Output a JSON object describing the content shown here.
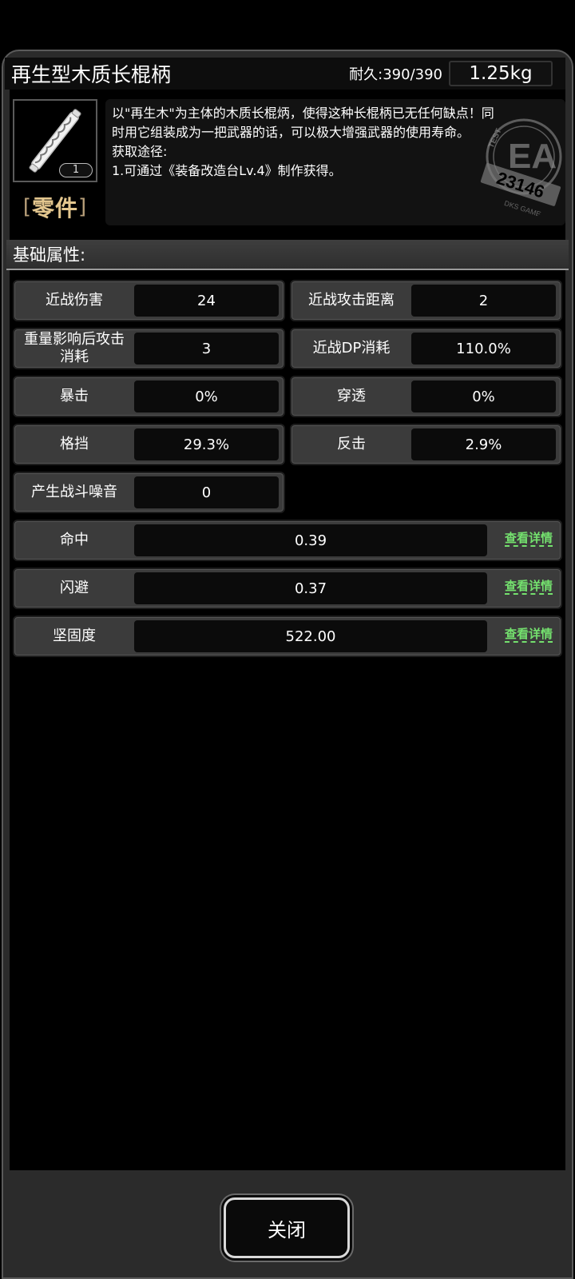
{
  "header": {
    "item_name": "再生型木质长棍柄",
    "durability": "耐久:390/390",
    "weight": "1.25kg"
  },
  "item": {
    "icon": "wooden-staff-handle-icon",
    "count": "1",
    "category": "零件",
    "description_lines": [
      "以\"再生木\"为主体的木质长棍炳，使得这种长棍柄已无任何缺点！同",
      "时用它组装成为一把武器的话，可以极大增强武器的使用寿命。",
      "获取途径:",
      "1.可通过《装备改造台Lv.4》制作获得。"
    ],
    "stamp": {
      "big": "EA",
      "small": "TEST",
      "number": "23146",
      "ring": "DKS GAME"
    }
  },
  "section": {
    "title": "基础属性:"
  },
  "stats_grid": [
    {
      "label": "近战伤害",
      "value": "24"
    },
    {
      "label": "近战攻击距离",
      "value": "2"
    },
    {
      "label": "重量影响后攻击消耗",
      "value": "3"
    },
    {
      "label": "近战DP消耗",
      "value": "110.0%"
    },
    {
      "label": "暴击",
      "value": "0%"
    },
    {
      "label": "穿透",
      "value": "0%"
    },
    {
      "label": "格挡",
      "value": "29.3%"
    },
    {
      "label": "反击",
      "value": "2.9%"
    },
    {
      "label": "产生战斗噪音",
      "value": "0"
    }
  ],
  "stats_wide": [
    {
      "label": "命中",
      "value": "0.39",
      "link": "查看详情"
    },
    {
      "label": "闪避",
      "value": "0.37",
      "link": "查看详情"
    },
    {
      "label": "坚固度",
      "value": "522.00",
      "link": "查看详情"
    }
  ],
  "footer": {
    "close_label": "关闭"
  },
  "colors": {
    "accent_gold": "#e3c68e",
    "link_green": "#74e06e"
  }
}
